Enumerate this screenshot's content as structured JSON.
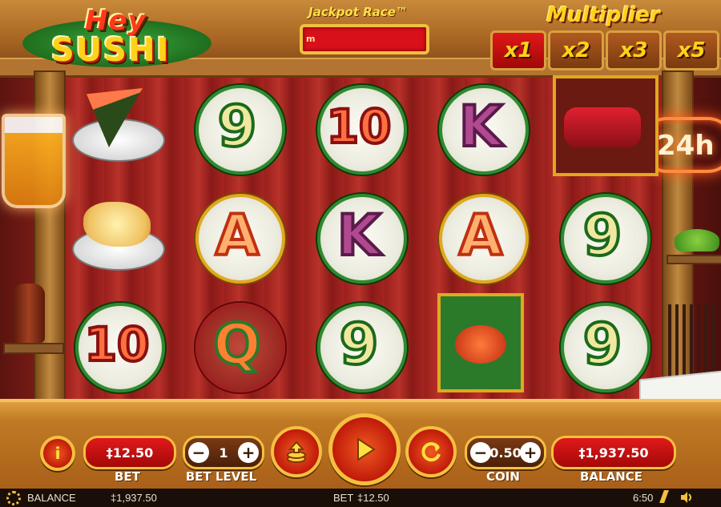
{
  "game": {
    "logo_line1": "Hey",
    "logo_line2": "SUSHI",
    "jackpot_title": "Jackpot Race™",
    "jackpot_marker": "m",
    "multiplier_title": "Multiplier",
    "multipliers": [
      {
        "label": "x1",
        "active": true
      },
      {
        "label": "x2",
        "active": false
      },
      {
        "label": "x3",
        "active": false
      },
      {
        "label": "x5",
        "active": false
      }
    ],
    "neon_sign": "24h"
  },
  "reels": [
    [
      {
        "symbol": "temaki-dish",
        "text": ""
      },
      {
        "symbol": "tempura-dish",
        "text": ""
      },
      {
        "symbol": "ten",
        "text": "10"
      }
    ],
    [
      {
        "symbol": "nine",
        "text": "9"
      },
      {
        "symbol": "ace",
        "text": "A"
      },
      {
        "symbol": "queen",
        "text": "Q"
      }
    ],
    [
      {
        "symbol": "ten",
        "text": "10"
      },
      {
        "symbol": "king",
        "text": "K"
      },
      {
        "symbol": "nine",
        "text": "9"
      }
    ],
    [
      {
        "symbol": "king",
        "text": "K"
      },
      {
        "symbol": "ace",
        "text": "A"
      },
      {
        "symbol": "crab",
        "text": ""
      }
    ],
    [
      {
        "symbol": "sushi-platter",
        "text": ""
      },
      {
        "symbol": "nine",
        "text": "9"
      },
      {
        "symbol": "nine",
        "text": "9"
      }
    ]
  ],
  "controls": {
    "info_label": "i",
    "bet_value": "‡12.50",
    "bet_label": "BET",
    "bet_level_value": "1",
    "bet_level_label": "BET LEVEL",
    "minus": "−",
    "plus": "+",
    "coin_value": "0.50",
    "coin_label": "COIN",
    "balance_value": "‡1,937.50",
    "balance_label": "BALANCE"
  },
  "status_bar": {
    "balance_label": "BALANCE",
    "balance_value": "‡1,937.50",
    "bet_label": "BET",
    "bet_value": "‡12.50",
    "time": "6:50"
  },
  "colors": {
    "accent_gold": "#f4c040",
    "button_red": "#d01010",
    "plate_green": "#2e8a2e"
  }
}
